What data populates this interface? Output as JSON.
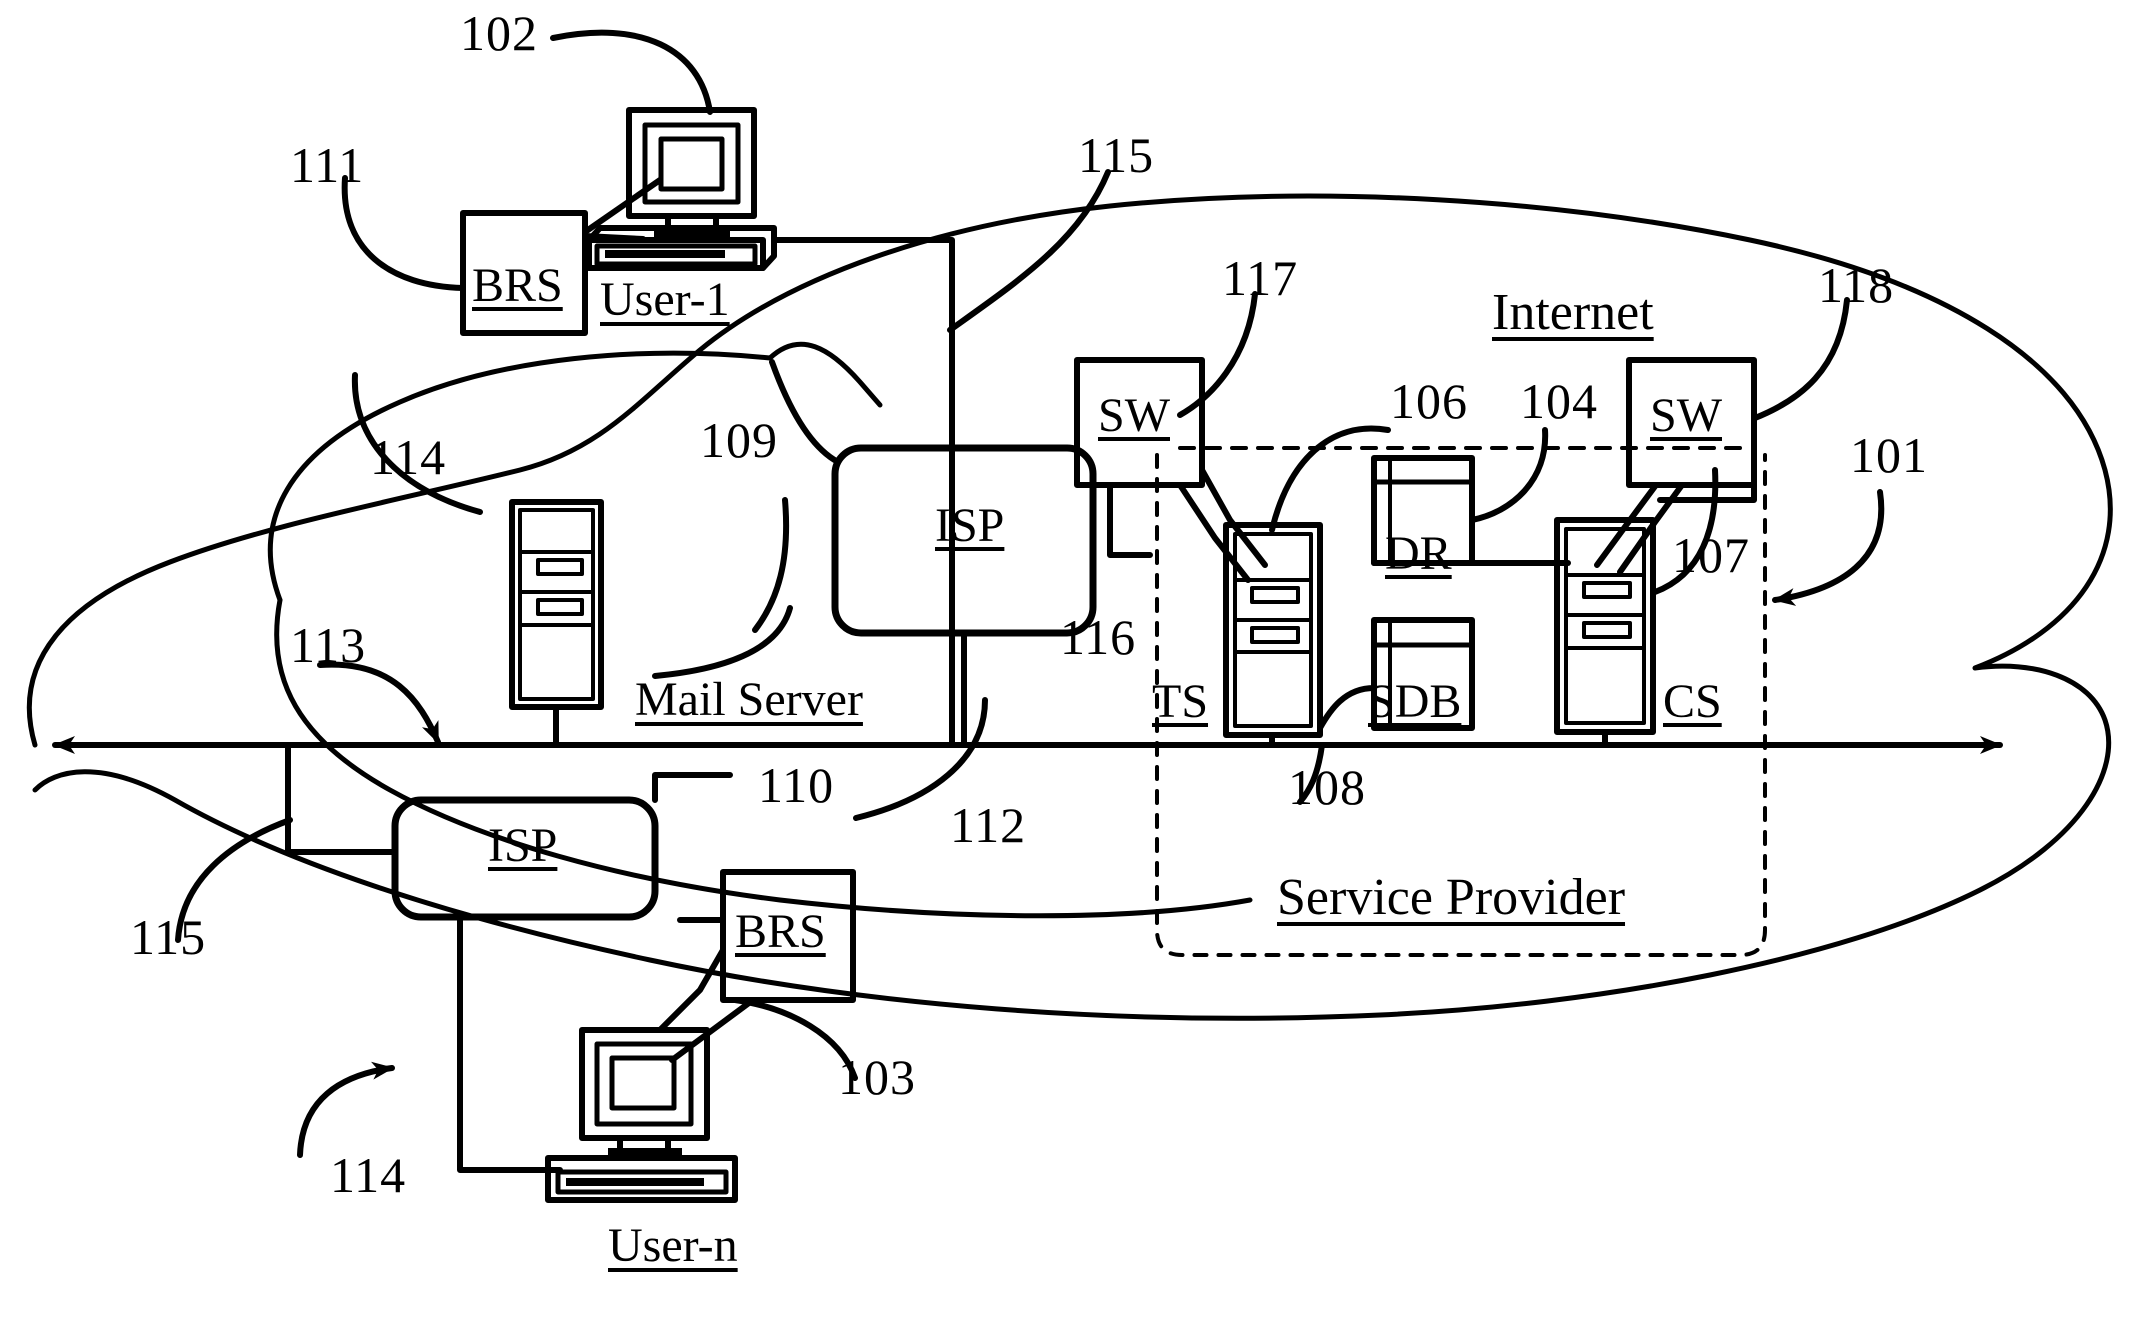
{
  "figure": {
    "type": "network-architecture-patent-diagram",
    "background_color": "#ffffff",
    "line_color": "#000000"
  },
  "regions": {
    "internet_cloud_label": "Internet",
    "service_provider_label": "Service Provider"
  },
  "nodes": {
    "user1_label": "User-1",
    "usern_label": "User-n",
    "mail_server_label": "Mail Server",
    "brs_top_label": "BRS",
    "brs_bottom_label": "BRS",
    "isp_top_label": "ISP",
    "isp_bottom_label": "ISP",
    "sw_left_label": "SW",
    "sw_right_label": "SW",
    "ts_label": "TS",
    "dr_label": "DR",
    "sdb_label": "SDB",
    "cs_label": "CS"
  },
  "reference_numerals": {
    "n101": "101",
    "n102": "102",
    "n103": "103",
    "n104": "104",
    "n106": "106",
    "n107": "107",
    "n108": "108",
    "n109": "109",
    "n110": "110",
    "n111": "111",
    "n112": "112",
    "n113": "113",
    "n114_top": "114",
    "n114_bottom": "114",
    "n115_top": "115",
    "n115_bottom": "115",
    "n116": "116",
    "n117": "117",
    "n118": "118"
  }
}
